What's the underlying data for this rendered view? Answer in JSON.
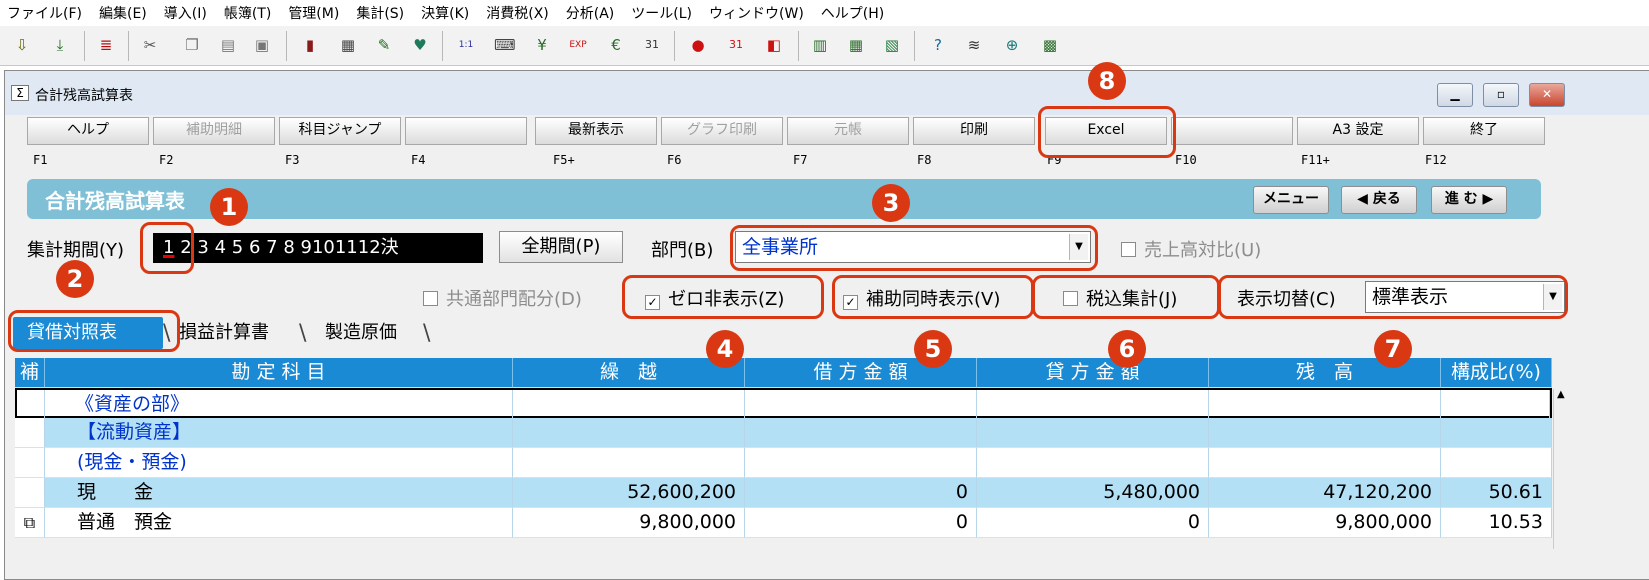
{
  "menu": [
    "ファイル(F)",
    "編集(E)",
    "導入(I)",
    "帳簿(T)",
    "管理(M)",
    "集計(S)",
    "決算(K)",
    "消費税(X)",
    "分析(A)",
    "ツール(L)",
    "ウィンドウ(W)",
    "ヘルプ(H)"
  ],
  "window": {
    "title": "合計残高試算表",
    "icon": "Σ"
  },
  "fkeys": [
    {
      "label": "ヘルプ",
      "key": "F1"
    },
    {
      "label": "補助明細",
      "key": "F2"
    },
    {
      "label": "科目ジャンプ",
      "key": "F3"
    },
    {
      "label": "",
      "key": "F4"
    },
    {
      "label": "最新表示",
      "key": "F5+"
    },
    {
      "label": "グラフ印刷",
      "key": "F6"
    },
    {
      "label": "元帳",
      "key": "F7"
    },
    {
      "label": "印刷",
      "key": "F8"
    },
    {
      "label": "Excel",
      "key": "F9"
    },
    {
      "label": "",
      "key": "F10"
    },
    {
      "label": "A3 設定",
      "key": "F11+"
    },
    {
      "label": "終了",
      "key": "F12"
    }
  ],
  "banner": {
    "title": "合計残高試算表",
    "menu": "メニュー",
    "back": "◀ 戻る",
    "forward": "進 む ▶"
  },
  "period": {
    "label": "集計期間(Y)",
    "months": [
      "1",
      "2",
      "3",
      "4",
      "5",
      "6",
      "7",
      "8",
      "9",
      "10",
      "11",
      "12",
      "決"
    ],
    "all_button": "全期間(P)"
  },
  "department": {
    "label": "部門(B)",
    "value": "全事業所"
  },
  "checks": {
    "sales_ratio": "売上高対比(U)",
    "common_dept": "共通部門配分(D)",
    "zero_hide": "ゼロ非表示(Z)",
    "aux_display": "補助同時表示(V)",
    "tax_incl": "税込集計(J)"
  },
  "display": {
    "label": "表示切替(C)",
    "value": "標準表示"
  },
  "tabs": [
    "貸借対照表",
    "損益計算書",
    "製造原価"
  ],
  "table": {
    "columns": [
      "補",
      "勘 定 科 目",
      "繰　越",
      "借 方 金 額",
      "貸 方 金 額",
      "残　高",
      "構成比(%)"
    ],
    "rows": [
      {
        "name": "《資産の部》",
        "carry": "",
        "debit": "",
        "credit": "",
        "balance": "",
        "ratio": ""
      },
      {
        "name": "【流動資産】",
        "carry": "",
        "debit": "",
        "credit": "",
        "balance": "",
        "ratio": ""
      },
      {
        "name": "(現金・預金)",
        "carry": "",
        "debit": "",
        "credit": "",
        "balance": "",
        "ratio": ""
      },
      {
        "name": "現　　金",
        "carry": "52,600,200",
        "debit": "0",
        "credit": "5,480,000",
        "balance": "47,120,200",
        "ratio": "50.61"
      },
      {
        "name": "普通　預金",
        "carry": "9,800,000",
        "debit": "0",
        "credit": "0",
        "balance": "9,800,000",
        "ratio": "10.53"
      }
    ]
  },
  "callouts": [
    "1",
    "2",
    "3",
    "4",
    "5",
    "6",
    "7",
    "8"
  ],
  "colors": {
    "accent": "#d93812",
    "header": "#1a8ad4",
    "banner": "#7fc0d6",
    "row_highlight": "#b3e0f5"
  }
}
